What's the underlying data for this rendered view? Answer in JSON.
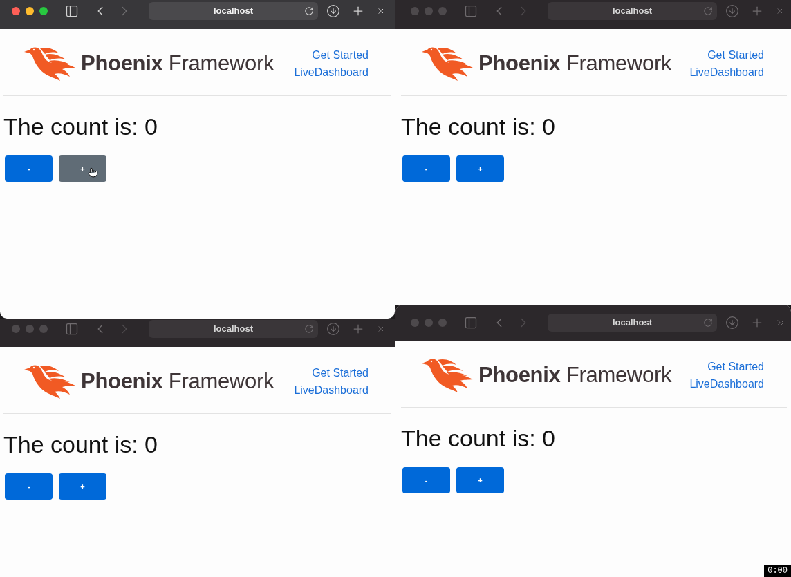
{
  "windows": [
    {
      "focused": true,
      "address": "localhost",
      "brand": "**Phoenix** Framework",
      "nav_links": [
        "Get Started",
        "LiveDashboard"
      ],
      "count_text": "The count is: 0",
      "buttons": [
        {
          "label": "-",
          "hovered": false
        },
        {
          "label": "+",
          "hovered": true
        }
      ]
    },
    {
      "focused": false,
      "address": "localhost",
      "brand": "**Phoenix** Framework",
      "nav_links": [
        "Get Started",
        "LiveDashboard"
      ],
      "count_text": "The count is: 0",
      "buttons": [
        {
          "label": "-",
          "hovered": false
        },
        {
          "label": "+",
          "hovered": false
        }
      ]
    },
    {
      "focused": false,
      "address": "localhost",
      "brand": "**Phoenix** Framework",
      "nav_links": [
        "Get Started",
        "LiveDashboard"
      ],
      "count_text": "The count is: 0",
      "buttons": [
        {
          "label": "-",
          "hovered": false
        },
        {
          "label": "+",
          "hovered": false
        }
      ]
    },
    {
      "focused": false,
      "address": "localhost",
      "brand": "**Phoenix** Framework",
      "nav_links": [
        "Get Started",
        "LiveDashboard"
      ],
      "count_text": "The count is: 0",
      "buttons": [
        {
          "label": "-",
          "hovered": false
        },
        {
          "label": "+",
          "hovered": false
        }
      ]
    }
  ],
  "recording_timer": "0:00"
}
